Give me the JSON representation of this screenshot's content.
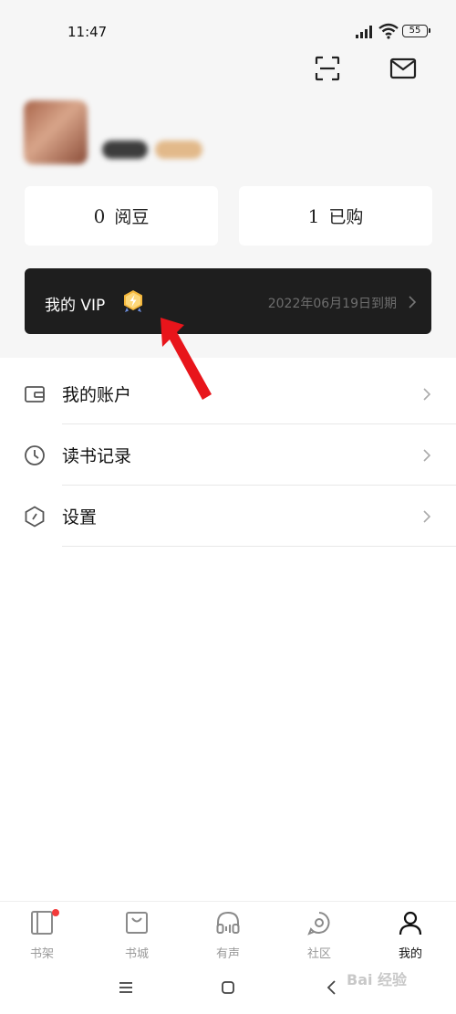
{
  "status_bar": {
    "time": "11:47",
    "battery": "55"
  },
  "stats": [
    {
      "value": "0",
      "label": "阅豆"
    },
    {
      "value": "1",
      "label": "已购"
    }
  ],
  "vip": {
    "label": "我的 VIP",
    "expire_text": "2022年06月19日到期"
  },
  "menu": [
    {
      "label": "我的账户",
      "icon": "wallet-icon"
    },
    {
      "label": "读书记录",
      "icon": "clock-icon"
    },
    {
      "label": "设置",
      "icon": "settings-icon"
    }
  ],
  "tabs": [
    {
      "label": "书架",
      "icon": "bookshelf-icon",
      "badge": true
    },
    {
      "label": "书城",
      "icon": "shopping-bag-icon"
    },
    {
      "label": "有声",
      "icon": "headphones-icon"
    },
    {
      "label": "社区",
      "icon": "community-icon"
    },
    {
      "label": "我的",
      "icon": "person-icon",
      "active": true
    }
  ],
  "watermark": "Bai 经验",
  "colors": {
    "vip_bg": "#1e1e1e",
    "page_top_bg": "#f6f6f6",
    "badge_red": "#f23a3a",
    "arrow_red": "#e8151b"
  }
}
